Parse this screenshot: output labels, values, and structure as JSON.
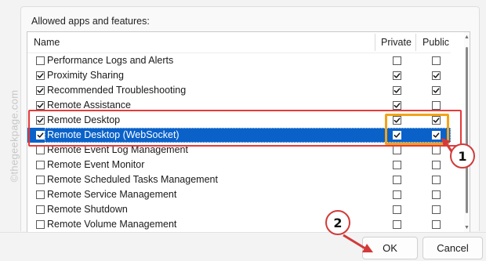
{
  "section_label": "Allowed apps and features:",
  "columns": {
    "name": "Name",
    "private": "Private",
    "public": "Public"
  },
  "rows": [
    {
      "label": "Performance Logs and Alerts",
      "enabled": false,
      "private": false,
      "public": false
    },
    {
      "label": "Proximity Sharing",
      "enabled": true,
      "private": true,
      "public": true
    },
    {
      "label": "Recommended Troubleshooting",
      "enabled": true,
      "private": true,
      "public": true
    },
    {
      "label": "Remote Assistance",
      "enabled": true,
      "private": true,
      "public": false
    },
    {
      "label": "Remote Desktop",
      "enabled": true,
      "private": true,
      "public": true
    },
    {
      "label": "Remote Desktop (WebSocket)",
      "enabled": true,
      "private": true,
      "public": true,
      "selected": true
    },
    {
      "label": "Remote Event Log Management",
      "enabled": false,
      "private": false,
      "public": false
    },
    {
      "label": "Remote Event Monitor",
      "enabled": false,
      "private": false,
      "public": false
    },
    {
      "label": "Remote Scheduled Tasks Management",
      "enabled": false,
      "private": false,
      "public": false
    },
    {
      "label": "Remote Service Management",
      "enabled": false,
      "private": false,
      "public": false
    },
    {
      "label": "Remote Shutdown",
      "enabled": false,
      "private": false,
      "public": false
    },
    {
      "label": "Remote Volume Management",
      "enabled": false,
      "private": false,
      "public": false
    }
  ],
  "buttons": {
    "ok": "OK",
    "cancel": "Cancel"
  },
  "annotations": {
    "badge_1": "1",
    "badge_2": "2"
  },
  "watermark": "©thegeekpage.com",
  "colors": {
    "selection": "#0a62c9",
    "highlight_red": "#e53a3a",
    "highlight_orange": "#f2a31a",
    "badge_border": "#d23a3a"
  }
}
